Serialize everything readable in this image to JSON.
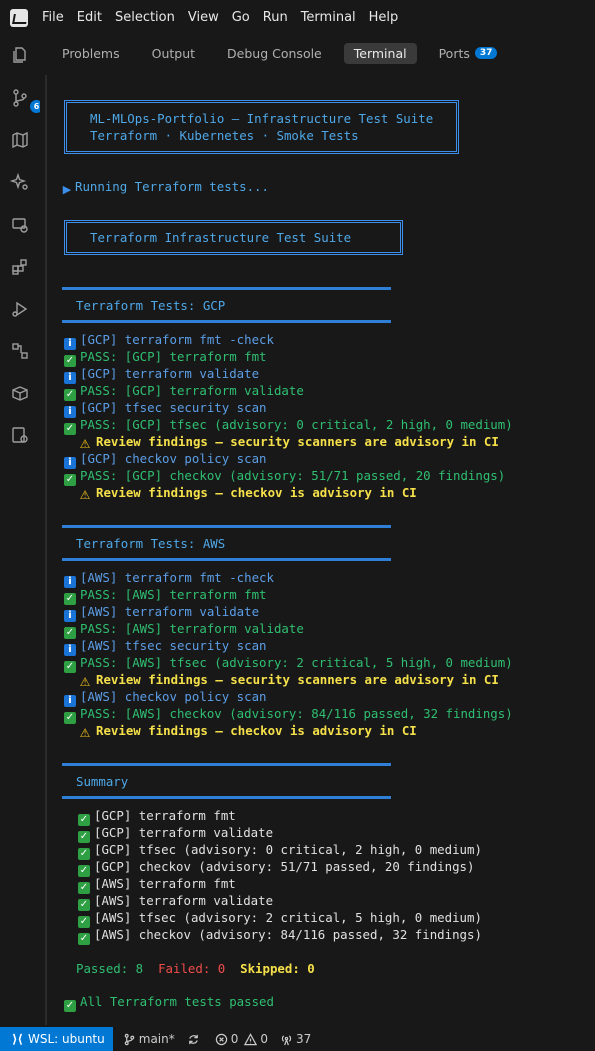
{
  "menu": [
    "File",
    "Edit",
    "Selection",
    "View",
    "Go",
    "Run",
    "Terminal",
    "Help"
  ],
  "activity": {
    "source_control_badge": "6"
  },
  "tabs": {
    "problems": "Problems",
    "output": "Output",
    "debug_console": "Debug Console",
    "terminal": "Terminal",
    "ports": "Ports",
    "ports_badge": "37"
  },
  "terminal": {
    "header_title": "ML-MLOps-Portfolio — Infrastructure Test Suite",
    "header_subtitle": "Terraform · Kubernetes · Smoke Tests",
    "running": "Running Terraform tests...",
    "suite_title": "Terraform Infrastructure Test Suite",
    "gcp_section": "Terraform Tests: GCP",
    "gcp_lines": [
      {
        "kind": "info",
        "text": "[GCP] terraform fmt -check"
      },
      {
        "kind": "pass",
        "text": "PASS: [GCP] terraform fmt"
      },
      {
        "kind": "info",
        "text": "[GCP] terraform validate"
      },
      {
        "kind": "pass",
        "text": "PASS: [GCP] terraform validate"
      },
      {
        "kind": "info",
        "text": "[GCP] tfsec security scan"
      },
      {
        "kind": "pass",
        "text": "PASS: [GCP] tfsec (advisory: 0 critical, 2 high, 0 medium)"
      },
      {
        "kind": "warn",
        "text": "Review findings — security scanners are advisory in CI"
      },
      {
        "kind": "info",
        "text": "[GCP] checkov policy scan"
      },
      {
        "kind": "pass",
        "text": "PASS: [GCP] checkov (advisory: 51/71 passed, 20 findings)"
      },
      {
        "kind": "warn",
        "text": "Review findings — checkov is advisory in CI"
      }
    ],
    "aws_section": "Terraform Tests: AWS",
    "aws_lines": [
      {
        "kind": "info",
        "text": "[AWS] terraform fmt -check"
      },
      {
        "kind": "pass",
        "text": "PASS: [AWS] terraform fmt"
      },
      {
        "kind": "info",
        "text": "[AWS] terraform validate"
      },
      {
        "kind": "pass",
        "text": "PASS: [AWS] terraform validate"
      },
      {
        "kind": "info",
        "text": "[AWS] tfsec security scan"
      },
      {
        "kind": "pass",
        "text": "PASS: [AWS] tfsec (advisory: 2 critical, 5 high, 0 medium)"
      },
      {
        "kind": "warn",
        "text": "Review findings — security scanners are advisory in CI"
      },
      {
        "kind": "info",
        "text": "[AWS] checkov policy scan"
      },
      {
        "kind": "pass",
        "text": "PASS: [AWS] checkov (advisory: 84/116 passed, 32 findings)"
      },
      {
        "kind": "warn",
        "text": "Review findings — checkov is advisory in CI"
      }
    ],
    "summary_section": "Summary",
    "summary_lines": [
      "[GCP] terraform fmt",
      "[GCP] terraform validate",
      "[GCP] tfsec (advisory: 0 critical, 2 high, 0 medium)",
      "[GCP] checkov (advisory: 51/71 passed, 20 findings)",
      "[AWS] terraform fmt",
      "[AWS] terraform validate",
      "[AWS] tfsec (advisory: 2 critical, 5 high, 0 medium)",
      "[AWS] checkov (advisory: 84/116 passed, 32 findings)"
    ],
    "passed_label": "Passed: 8",
    "failed_label": "Failed: 0",
    "skipped_label": "Skipped: 0",
    "final": "All Terraform tests passed"
  },
  "status": {
    "remote": "WSL: ubuntu",
    "branch": "main*",
    "errors": "0",
    "warnings": "0",
    "ports": "37"
  },
  "colors": {
    "accent": "#0078d4",
    "pass": "#2fbf71",
    "info": "#5c9ee6",
    "warn": "#f5e04a",
    "fail": "#f14c4c"
  }
}
